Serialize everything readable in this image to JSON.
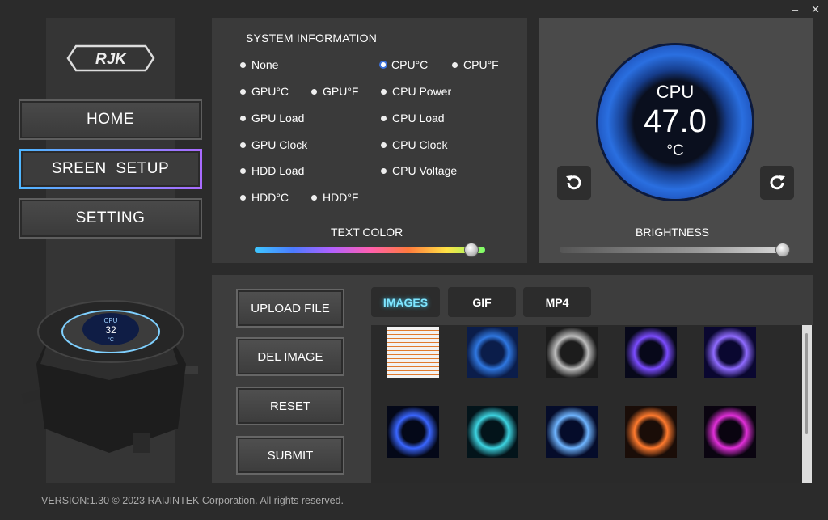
{
  "window": {
    "minimize_label": "–",
    "close_label": "✕"
  },
  "brand": {
    "logo_text": "RJK"
  },
  "nav": {
    "items": [
      {
        "label": "HOME",
        "active": false
      },
      {
        "label": "SREEN  SETUP",
        "active": true
      },
      {
        "label": "SETTING",
        "active": false
      }
    ]
  },
  "device_display": {
    "label": "CPU",
    "value": "32",
    "unit": "°C"
  },
  "system_info": {
    "title": "SYSTEM INFORMATION",
    "options": [
      {
        "label": "None",
        "selected": false
      },
      {
        "label": "CPU°C",
        "selected": true
      },
      {
        "label": "CPU°F",
        "selected": false
      },
      {
        "label": "GPU°C",
        "selected": false
      },
      {
        "label": "GPU°F",
        "selected": false
      },
      {
        "label": "CPU Power",
        "selected": false
      },
      {
        "label": "GPU Load",
        "selected": false
      },
      {
        "label": "CPU Load",
        "selected": false
      },
      {
        "label": "GPU Clock",
        "selected": false
      },
      {
        "label": "CPU Clock",
        "selected": false
      },
      {
        "label": "HDD Load",
        "selected": false
      },
      {
        "label": "CPU Voltage",
        "selected": false
      },
      {
        "label": "HDD°C",
        "selected": false
      },
      {
        "label": "HDD°F",
        "selected": false
      }
    ],
    "text_color_label": "TEXT COLOR",
    "text_color_value": 0.97
  },
  "preview": {
    "label": "CPU",
    "value": "47.0",
    "unit": "°C",
    "brightness_label": "BRIGHTNESS",
    "brightness_value": 1.0,
    "rotate_left_icon": "rotate-ccw-icon",
    "rotate_right_icon": "rotate-cw-icon"
  },
  "actions": {
    "upload": "UPLOAD FILE",
    "delete": "DEL IMAGE",
    "reset": "RESET",
    "submit": "SUBMIT"
  },
  "media_tabs": [
    {
      "label": "IMAGES",
      "active": true
    },
    {
      "label": "GIF",
      "active": false
    },
    {
      "label": "MP4",
      "active": false
    }
  ],
  "gallery": {
    "thumbnails": [
      {
        "name": "screenshot-thumb",
        "colors": [
          "#f2f2f2",
          "#e07a2e"
        ]
      },
      {
        "name": "blue-eye-thumb",
        "colors": [
          "#0b1d4a",
          "#2f77e0"
        ]
      },
      {
        "name": "turbine-thumb",
        "colors": [
          "#1c1c1c",
          "#bdbdbd"
        ]
      },
      {
        "name": "neon-ring-thumb",
        "colors": [
          "#07081a",
          "#7b4cff"
        ]
      },
      {
        "name": "purple-ring-thumb",
        "colors": [
          "#0a0730",
          "#8f6bff"
        ]
      },
      {
        "name": "blue-vortex-thumb",
        "colors": [
          "#040818",
          "#3a66ff"
        ]
      },
      {
        "name": "particle-thumb",
        "colors": [
          "#03141a",
          "#3dd3e0"
        ]
      },
      {
        "name": "light-ring-thumb",
        "colors": [
          "#050c2a",
          "#6fb5ff"
        ]
      },
      {
        "name": "warp-thumb",
        "colors": [
          "#1a0d08",
          "#ff7a2e"
        ]
      },
      {
        "name": "neon-blob-thumb",
        "colors": [
          "#0a0410",
          "#e02fd8"
        ]
      }
    ]
  },
  "footer": {
    "text": "VERSION:1.30 © 2023 RAIJINTEK Corporation. All rights reserved."
  }
}
